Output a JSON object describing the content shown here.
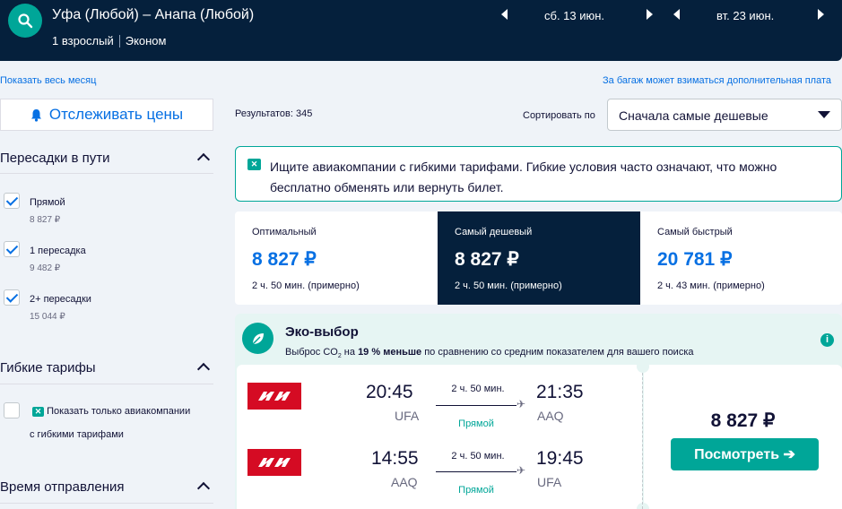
{
  "header": {
    "route": "Уфа (Любой) – Анапа (Любой)",
    "passengers": "1 взрослый",
    "cabin": "Эконом",
    "depart_date": "сб. 13 июн.",
    "return_date": "вт. 23 июн."
  },
  "links": {
    "show_month": "Показать весь месяц",
    "baggage_note": "За багаж может взиматься дополнительная плата"
  },
  "sidebar": {
    "track_label": "Отслеживать цены",
    "stops": {
      "title": "Пересадки в пути",
      "options": [
        {
          "label": "Прямой",
          "price": "8 827 ₽",
          "checked": true
        },
        {
          "label": "1 пересадка",
          "price": "9 482 ₽",
          "checked": true
        },
        {
          "label": "2+ пересадки",
          "price": "15 044 ₽",
          "checked": true
        }
      ]
    },
    "flex": {
      "title": "Гибкие тарифы",
      "option_line1": "Показать только авиакомпании",
      "option_line2": "с гибкими тарифами"
    },
    "departure": {
      "title": "Время отправления"
    }
  },
  "results": {
    "count_label": "Результатов: 345",
    "sort_label": "Сортировать по",
    "sort_value": "Сначала самые дешевые"
  },
  "banner": {
    "text": "Ищите авиакомпании с гибкими тарифами. Гибкие условия часто означают, что можно бесплатно обменять или вернуть билет."
  },
  "tabs": [
    {
      "title": "Оптимальный",
      "price": "8 827 ₽",
      "time": "2 ч. 50 мин. (примерно)"
    },
    {
      "title": "Самый дешевый",
      "price": "8 827 ₽",
      "time": "2 ч. 50 мин. (примерно)"
    },
    {
      "title": "Самый быстрый",
      "price": "20 781 ₽",
      "time": "2 ч. 43 мин. (примерно)"
    }
  ],
  "eco": {
    "title": "Эко-выбор",
    "desc_prefix": "Выброс CO",
    "desc_sub": "2",
    "desc_mid": " на ",
    "desc_bold": "19 % меньше",
    "desc_suffix": " по сравнению со средним показателем для вашего поиска"
  },
  "ticket": {
    "outbound": {
      "dep_time": "20:45",
      "dep_code": "UFA",
      "duration": "2 ч. 50 мин.",
      "stops": "Прямой",
      "arr_time": "21:35",
      "arr_code": "AAQ"
    },
    "inbound": {
      "dep_time": "14:55",
      "dep_code": "AAQ",
      "duration": "2 ч. 50 мин.",
      "stops": "Прямой",
      "arr_time": "19:45",
      "arr_code": "UFA"
    },
    "price": "8 827 ₽",
    "button": "Посмотреть ➔"
  },
  "colors": {
    "navy": "#05203c",
    "teal": "#00a698",
    "blue": "#0770e3",
    "airline_red": "#d50b23"
  }
}
